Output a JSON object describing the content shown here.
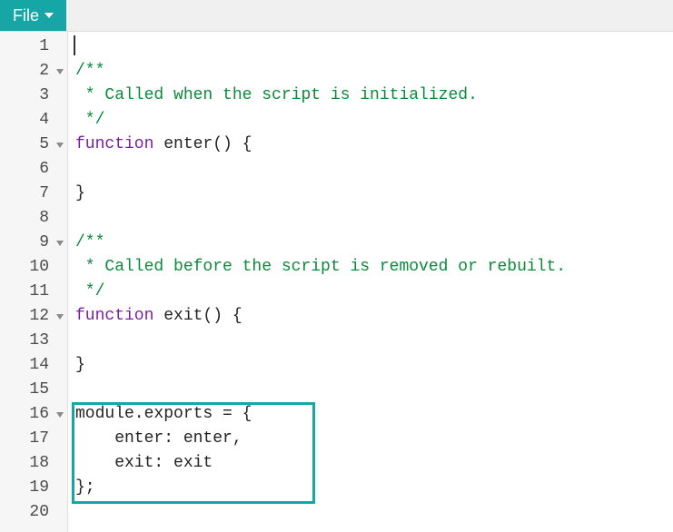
{
  "header": {
    "file_label": "File"
  },
  "gutter": [
    {
      "n": "1",
      "fold": false
    },
    {
      "n": "2",
      "fold": true
    },
    {
      "n": "3",
      "fold": false
    },
    {
      "n": "4",
      "fold": false
    },
    {
      "n": "5",
      "fold": true
    },
    {
      "n": "6",
      "fold": false
    },
    {
      "n": "7",
      "fold": false
    },
    {
      "n": "8",
      "fold": false
    },
    {
      "n": "9",
      "fold": true
    },
    {
      "n": "10",
      "fold": false
    },
    {
      "n": "11",
      "fold": false
    },
    {
      "n": "12",
      "fold": true
    },
    {
      "n": "13",
      "fold": false
    },
    {
      "n": "14",
      "fold": false
    },
    {
      "n": "15",
      "fold": false
    },
    {
      "n": "16",
      "fold": true
    },
    {
      "n": "17",
      "fold": false
    },
    {
      "n": "18",
      "fold": false
    },
    {
      "n": "19",
      "fold": false
    },
    {
      "n": "20",
      "fold": false
    }
  ],
  "code": {
    "l1": "",
    "l2": "/**",
    "l3": " * Called when the script is initialized.",
    "l4": " */",
    "l5a": "function",
    "l5b": " enter() {",
    "l6": "",
    "l7": "}",
    "l8": "",
    "l9": "/**",
    "l10": " * Called before the script is removed or rebuilt.",
    "l11": " */",
    "l12a": "function",
    "l12b": " exit() {",
    "l13": "",
    "l14": "}",
    "l15": "",
    "l16": "module.exports = {",
    "l17": "    enter: enter,",
    "l18": "    exit: exit",
    "l19": "};",
    "l20": ""
  }
}
